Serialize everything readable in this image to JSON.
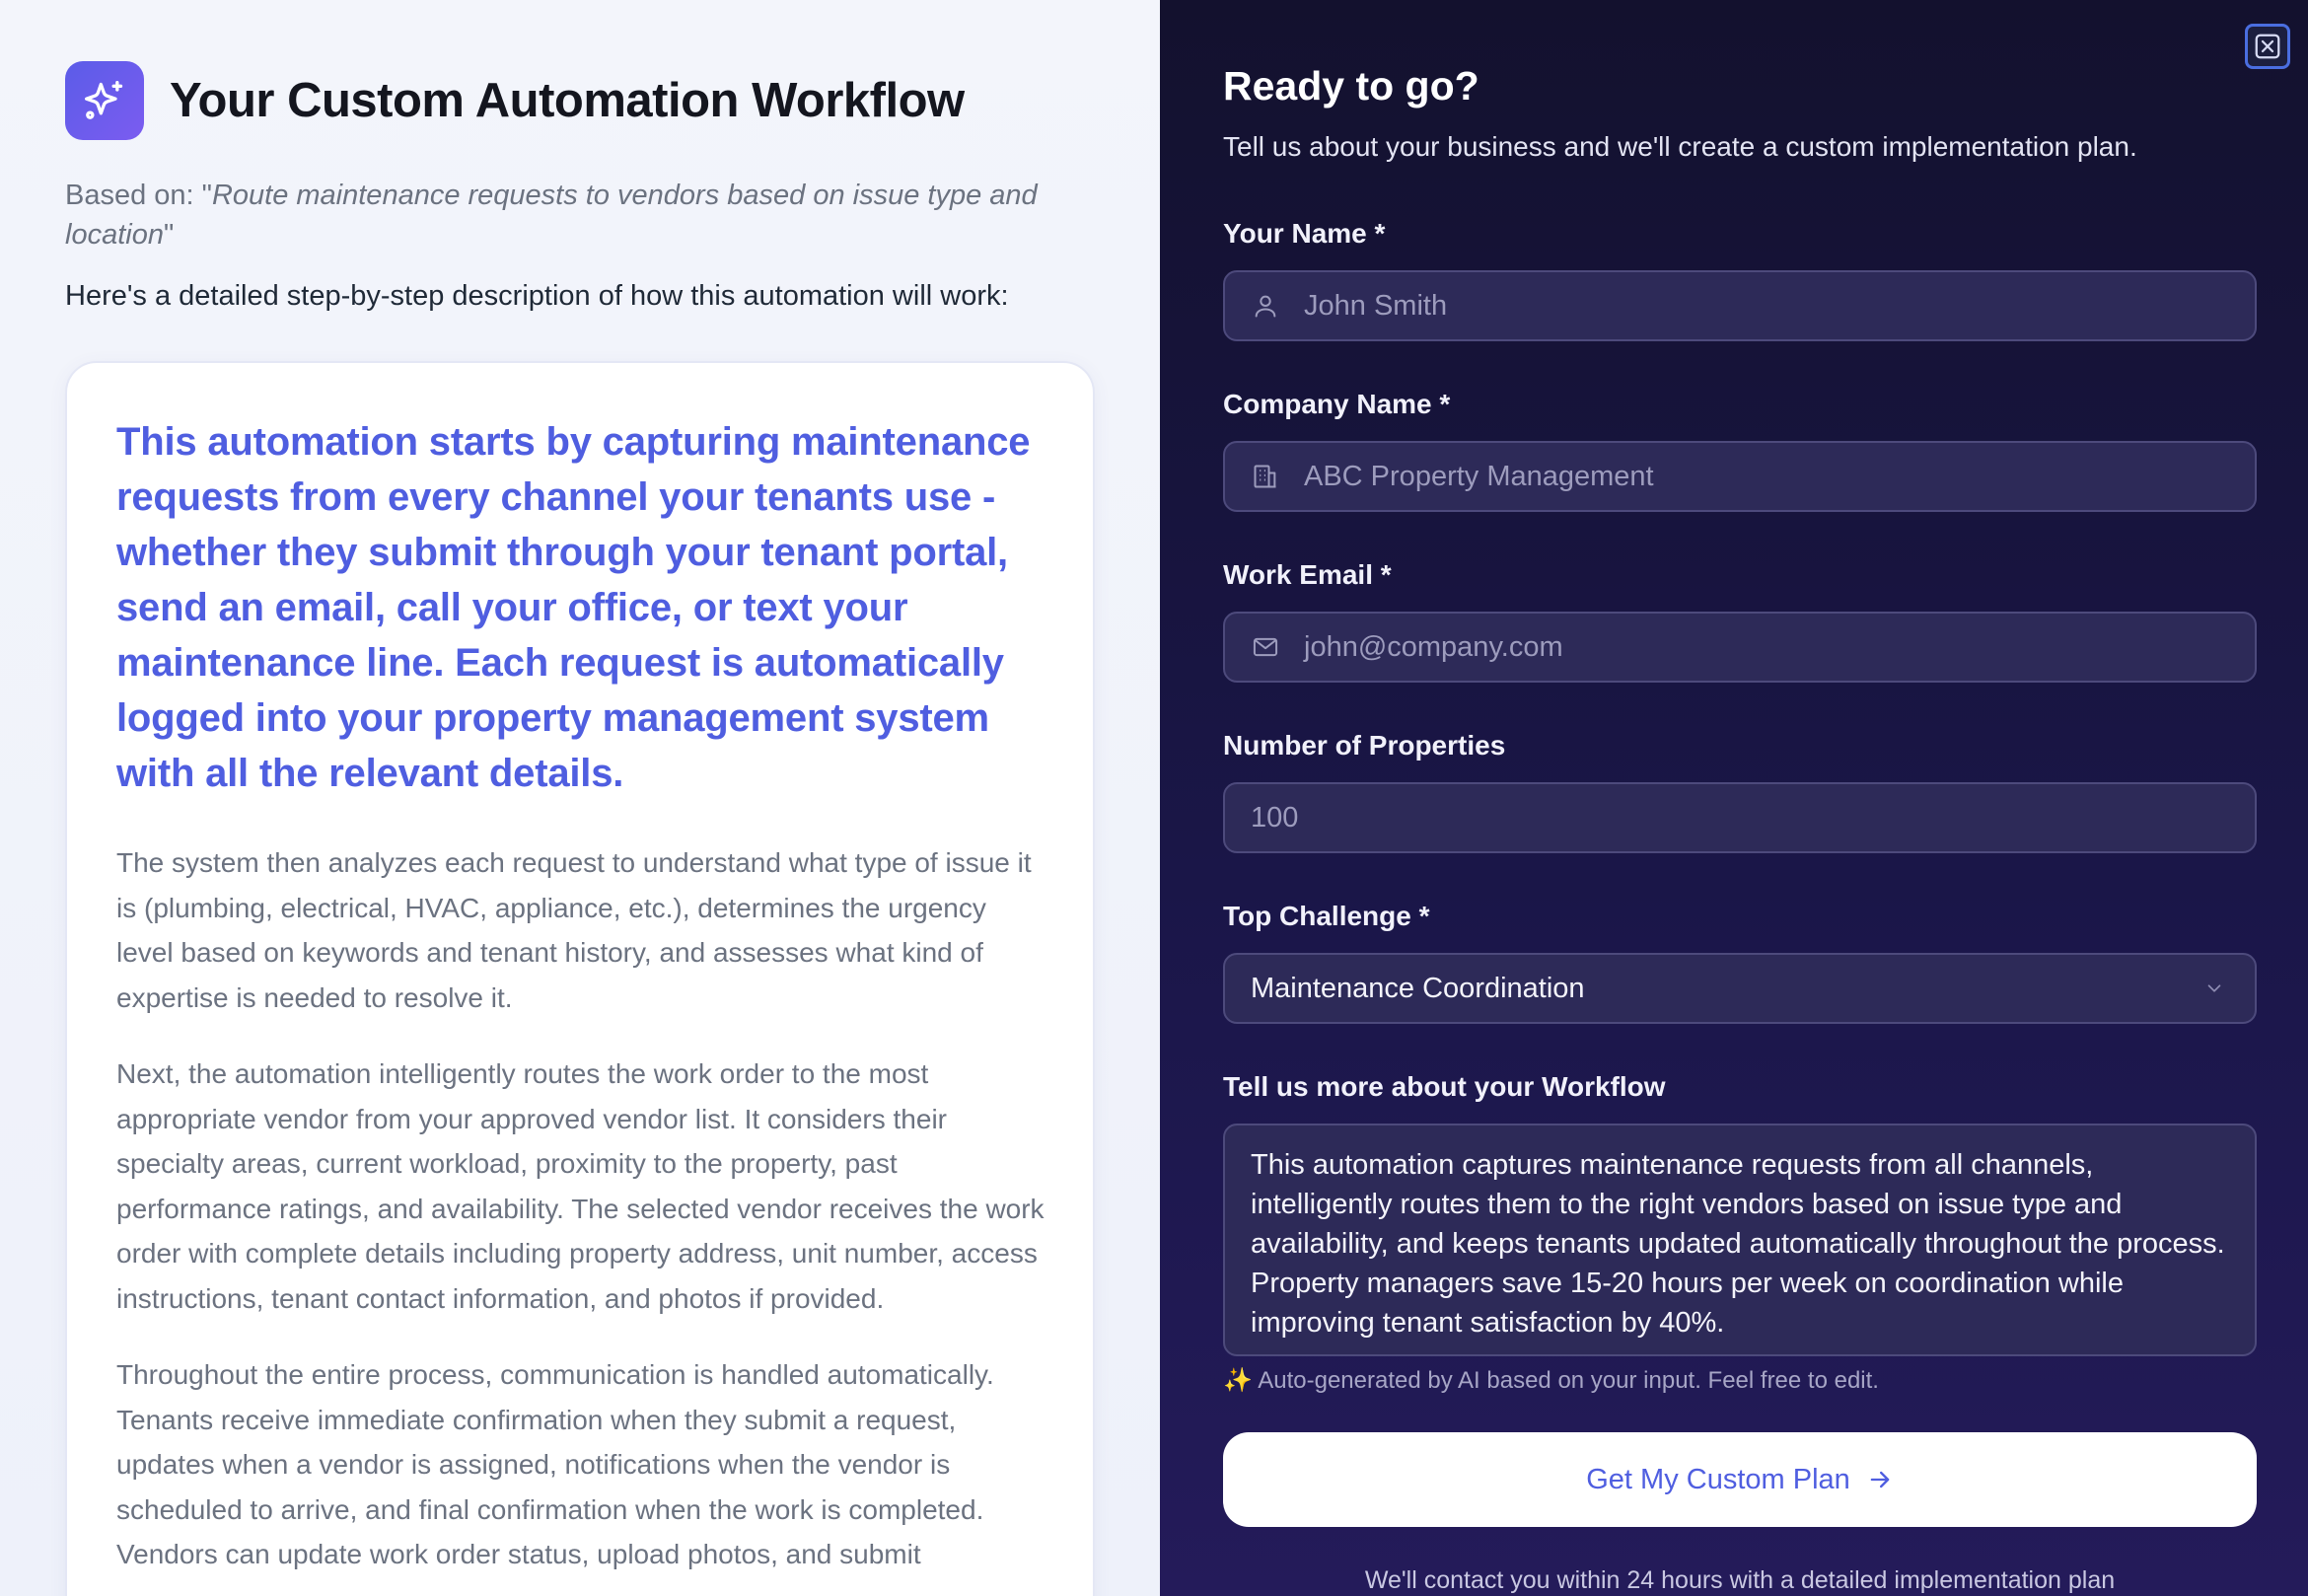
{
  "left": {
    "title": "Your Custom Automation Workflow",
    "based_prefix": "Based on: \"",
    "based_query": "Route maintenance requests to vendors based on issue type and location",
    "based_suffix": "\"",
    "intro": "Here's a detailed step-by-step description of how this automation will work:",
    "lead": "This automation starts by capturing maintenance requests from every channel your tenants use - whether they submit through your tenant portal, send an email, call your office, or text your maintenance line. Each request is automatically logged into your property management system with all the relevant details.",
    "paragraphs": [
      "The system then analyzes each request to understand what type of issue it is (plumbing, electrical, HVAC, appliance, etc.), determines the urgency level based on keywords and tenant history, and assesses what kind of expertise is needed to resolve it.",
      "Next, the automation intelligently routes the work order to the most appropriate vendor from your approved vendor list. It considers their specialty areas, current workload, proximity to the property, past performance ratings, and availability. The selected vendor receives the work order with complete details including property address, unit number, access instructions, tenant contact information, and photos if provided.",
      "Throughout the entire process, communication is handled automatically. Tenants receive immediate confirmation when they submit a request, updates when a vendor is assigned, notifications when the vendor is scheduled to arrive, and final confirmation when the work is completed. Vendors can update work order status, upload photos, and submit"
    ]
  },
  "right": {
    "title": "Ready to go?",
    "subtitle": "Tell us about your business and we'll create a custom implementation plan.",
    "name_label": "Your Name *",
    "name_placeholder": "John Smith",
    "company_label": "Company Name *",
    "company_placeholder": "ABC Property Management",
    "email_label": "Work Email *",
    "email_placeholder": "john@company.com",
    "properties_label": "Number of Properties",
    "properties_placeholder": "100",
    "challenge_label": "Top Challenge *",
    "challenge_value": "Maintenance Coordination",
    "workflow_label": "Tell us more about your Workflow",
    "workflow_text": "This automation captures maintenance requests from all channels, intelligently routes them to the right vendors based on issue type and availability, and keeps tenants updated automatically throughout the process. Property managers save 15-20 hours per week on coordination while improving tenant satisfaction by 40%.",
    "hint": "✨ Auto-generated by AI based on your input. Feel free to edit.",
    "submit_label": "Get My Custom Plan",
    "footer": "We'll contact you within 24 hours with a detailed implementation plan"
  },
  "colors": {
    "accent": "#4f5ee0",
    "panel_dark": "#1a1648",
    "input_bg": "#2d2a58"
  },
  "icons": [
    "sparkles-icon",
    "close-icon",
    "user-icon",
    "building-icon",
    "mail-icon",
    "chevron-down-icon",
    "arrow-right-icon"
  ]
}
